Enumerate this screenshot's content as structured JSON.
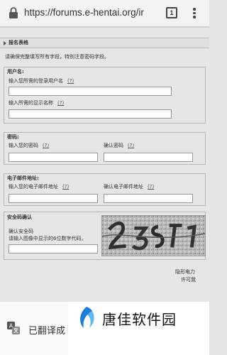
{
  "browser": {
    "url": "https://forums.e-hentai.org/ir",
    "tab_count": "1"
  },
  "form": {
    "section_title": "报名表格",
    "notice": "请确保完整填写所有字段，特别注意密码字段。",
    "username": {
      "legend": "用户名:",
      "login_label": "输入您所需的登录用户名",
      "display_label": "输入所需的显示名称",
      "help": "(?)"
    },
    "password": {
      "legend": "密码:",
      "password_label": "输入您的密码",
      "confirm_label": "确认密码",
      "help": "(?)"
    },
    "email": {
      "legend": "电子邮件地址:",
      "email_label": "输入您的电子邮件地址",
      "confirm_label": "确认电子邮件地址",
      "help": "(?)"
    },
    "captcha": {
      "legend": "安全码确认",
      "label_line1": "确认安全码",
      "label_line2": "请输入图像中显示的6位数字代码。"
    },
    "footer": {
      "line1": "隐形电力",
      "line2": "许可我"
    }
  },
  "bottom": {
    "translated": "已翻译成",
    "watermark": "唐佳软件园"
  }
}
